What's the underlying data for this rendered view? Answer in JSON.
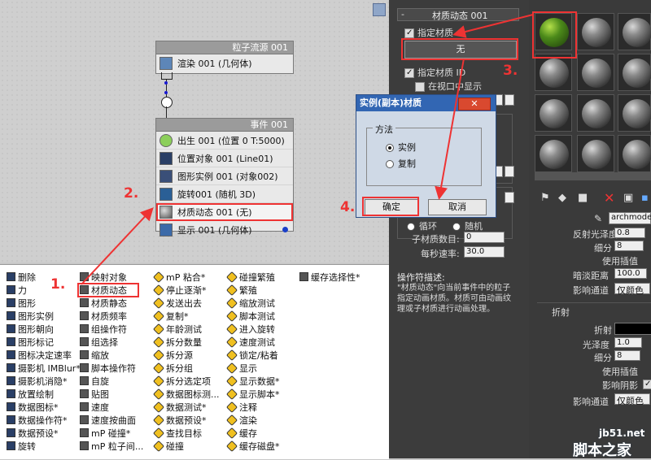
{
  "canvas": {
    "flow_node": {
      "title": "粒子流源 001",
      "row": "渲染 001 (几何体)"
    },
    "event_node": {
      "title": "事件 001",
      "rows": [
        "出生 001 (位置 0 T:5000)",
        "位置对象 001 (Line01)",
        "图形实例 001 (对象002)",
        "旋转001 (随机 3D)",
        "材质动态 001 (无)",
        "显示 001 (几何体)"
      ]
    }
  },
  "annotations": [
    "1.",
    "2.",
    "3.",
    "4."
  ],
  "operators": {
    "col1": [
      "删除",
      "力",
      "图形",
      "图形实例",
      "图形朝向",
      "图形标记",
      "图标决定速率",
      "摄影机 IMBlur*",
      "摄影机消隐*",
      "放置绘制",
      "数据图标*",
      "数据操作符*",
      "数据预设*",
      "旋转"
    ],
    "col2": [
      "映射对象",
      "材质动态",
      "材质静态",
      "材质频率",
      "组操作符",
      "组选择",
      "缩放",
      "脚本操作符",
      "自旋",
      "贴图",
      "速度",
      "速度按曲面",
      "mP 碰撞*",
      "mP 粒子间..."
    ],
    "col3": [
      "mP 粘合*",
      "停止逐渐*",
      "发送出去",
      "复制*",
      "年龄测试",
      "拆分数量",
      "拆分源",
      "拆分组",
      "拆分选定项",
      "数据图标测...",
      "数据测试*",
      "数据预设*",
      "查找目标",
      "碰撞"
    ],
    "col4": [
      "碰撞繁殖",
      "繁殖",
      "缩放测试",
      "脚本测试",
      "进入旋转",
      "速度测试",
      "锁定/粘着",
      "显示",
      "显示数据*",
      "显示脚本*",
      "注释",
      "渲染",
      "缓存",
      "缓存磁盘*"
    ],
    "col5": [
      "缓存选择性*"
    ]
  },
  "panel": {
    "rollout_title": "材质动态 001",
    "assign_material": "指定材质",
    "none_button": "无",
    "assign_id": "指定材质 ID",
    "show_in_viewport": "在视口中显示",
    "cycle": "循环",
    "random": "随机",
    "sub_material_count_label": "子材质数目:",
    "sub_material_count": "0",
    "rate_per_sec_label": "每秒速率:",
    "rate_per_sec": "30.0",
    "desc_title": "操作符描述:",
    "desc_text": "\"材质动态\"向当前事件中的粒子指定动画材质。材质可由动画纹理或子材质进行动画处理。"
  },
  "dialog": {
    "title": "实例(副本)材质",
    "method_label": "方法",
    "option_instance": "实例",
    "option_copy": "复制",
    "ok": "确定",
    "cancel": "取消"
  },
  "material_editor": {
    "name_field": "archmodel",
    "reflect_gloss_label": "反射光泽度",
    "reflect_gloss": "0.8",
    "subdivs_label": "细分",
    "subdivs": "8",
    "use_interp": "使用插值",
    "dim_distance_label": "暗淡距离",
    "dim_distance": "100.0",
    "affect_channel_label": "影响通道",
    "affect_channel": "仅颜色",
    "refraction_header": "折射",
    "refract_label": "折射",
    "gloss_label": "光泽度",
    "gloss": "1.0",
    "subdivs2": "8",
    "use_interp2": "使用插值",
    "affect_shadows": "影响阴影",
    "affect_channel2": "仅颜色"
  },
  "watermark": {
    "site": "jb51.net",
    "name": "脚本之家"
  }
}
